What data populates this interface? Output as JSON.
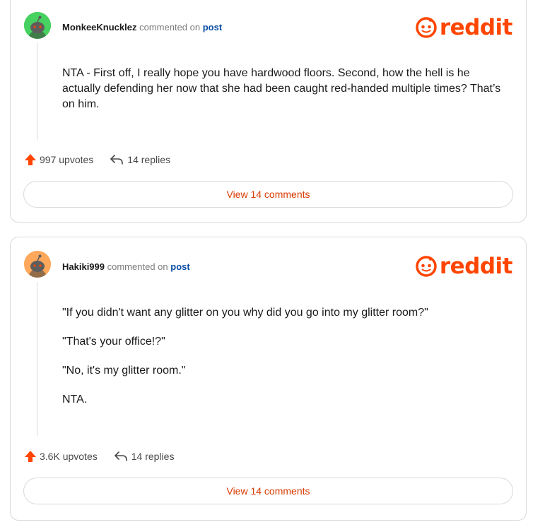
{
  "brand": {
    "logo_text": "reddit",
    "color": "#ff4500"
  },
  "comments": [
    {
      "username": "MonkeeKnucklez",
      "action_text": "commented on",
      "post_link": "post",
      "avatar_color": "#46d160",
      "paragraphs": [
        "NTA - First off, I really hope you have hardwood floors. Second, how the hell is he actually defending her now that she had been caught red-handed multiple times? That’s on him."
      ],
      "upvotes": "997 upvotes",
      "replies": "14 replies",
      "view_comments": "View 14 comments"
    },
    {
      "username": "Hakiki999",
      "action_text": "commented on",
      "post_link": "post",
      "avatar_color": "#ffa85c",
      "paragraphs": [
        "\"If you didn't want any glitter on you why did you go into my glitter room?\"",
        "\"That's your office!?\"",
        "\"No, it's my glitter room.\"",
        "NTA."
      ],
      "upvotes": "3.6K upvotes",
      "replies": "14 replies",
      "view_comments": "View 14 comments"
    }
  ]
}
